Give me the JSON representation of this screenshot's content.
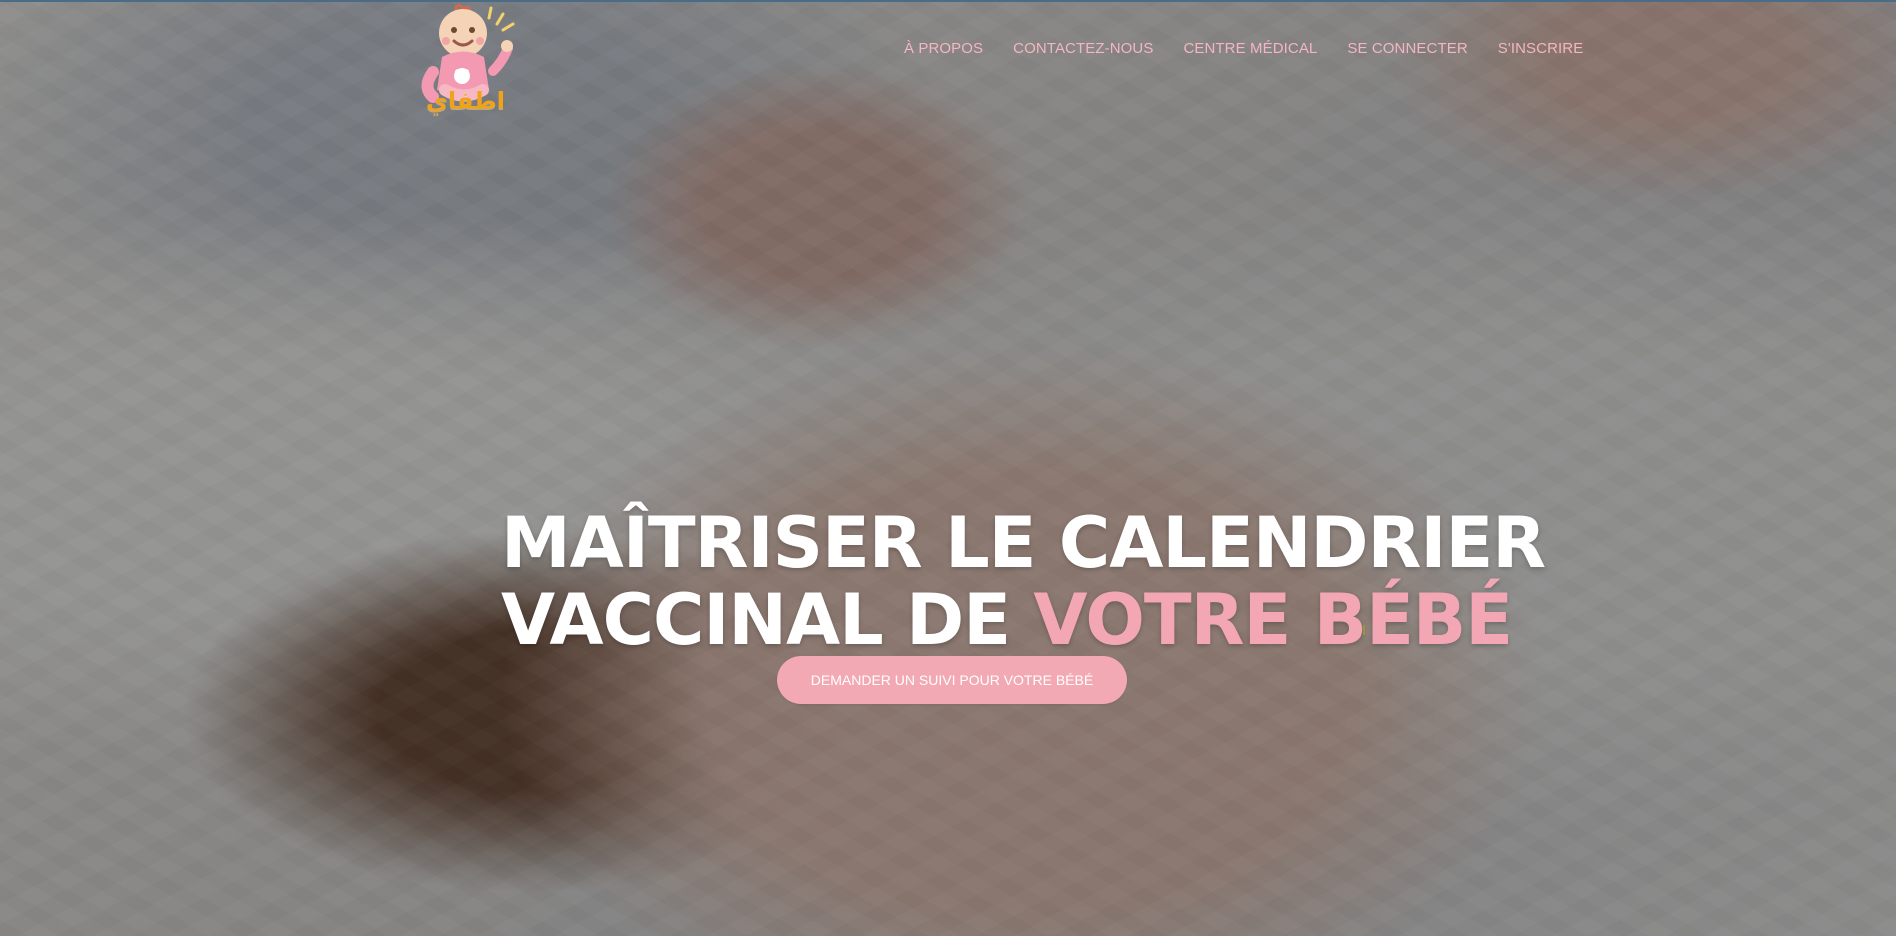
{
  "logo": {
    "text": "اطفاي",
    "icon": "baby-logo-icon"
  },
  "nav": {
    "items": [
      {
        "label": "À PROPOS"
      },
      {
        "label": "CONTACTEZ-NOUS"
      },
      {
        "label": "CENTRE MÉDICAL"
      },
      {
        "label": "SE CONNECTER"
      },
      {
        "label": "S'INSCRIRE"
      }
    ]
  },
  "hero": {
    "line1": "MAÎTRISER LE CALENDRIER",
    "line2_prefix": "VACCINAL DE",
    "line2_highlight": "VOTRE BÉBÉ",
    "cta_label": "DEMANDER UN SUIVI POUR VOTRE BÉBÉ"
  },
  "colors": {
    "accent_pink": "#f3a7b5",
    "logo_orange": "#f0a319",
    "overlay": "#000000"
  }
}
